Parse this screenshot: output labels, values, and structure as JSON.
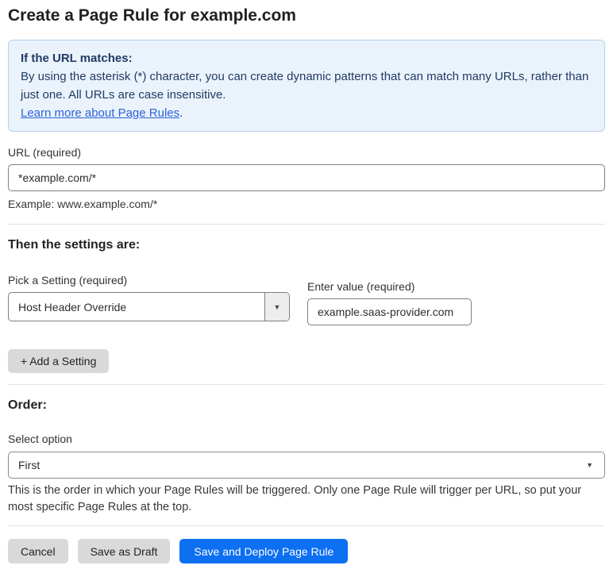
{
  "page": {
    "title": "Create a Page Rule for example.com"
  },
  "info_box": {
    "heading": "If the URL matches:",
    "body": "By using the asterisk (*) character, you can create dynamic patterns that can match many URLs, rather than just one. All URLs are case insensitive.",
    "link_label": "Learn more about Page Rules",
    "link_suffix": "."
  },
  "url_section": {
    "label": "URL (required)",
    "value": "*example.com/*",
    "helper": "Example: www.example.com/*"
  },
  "settings_section": {
    "heading": "Then the settings are:",
    "setting_label": "Pick a Setting (required)",
    "setting_value": "Host Header Override",
    "value_label": "Enter value (required)",
    "value_value": "example.saas-provider.com",
    "add_button_label": "+ Add a Setting"
  },
  "order_section": {
    "heading": "Order:",
    "select_label": "Select option",
    "select_value": "First",
    "helper": "This is the order in which your Page Rules will be triggered. Only one Page Rule will trigger per URL, so put your most specific Page Rules at the top."
  },
  "footer": {
    "cancel_label": "Cancel",
    "save_draft_label": "Save as Draft",
    "save_deploy_label": "Save and Deploy Page Rule"
  },
  "icons": {
    "dropdown_arrow": "▼"
  },
  "colors": {
    "accent_blue": "#0d6ff2",
    "info_box_bg": "#eaf3fc",
    "info_box_border": "#b3d0ee",
    "info_text": "#223a65",
    "link_blue": "#2c62d9",
    "gray_button_bg": "#d9d9d9"
  }
}
